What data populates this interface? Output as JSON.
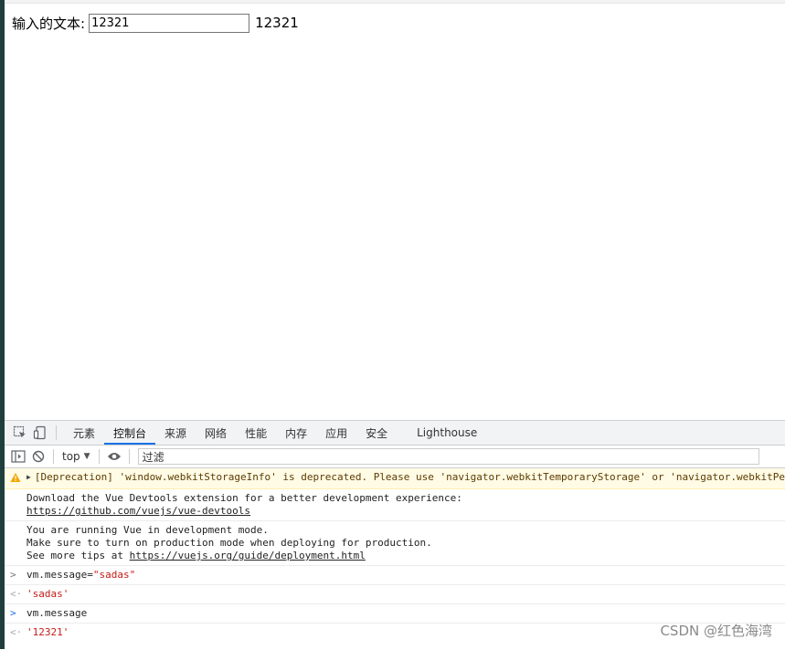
{
  "page": {
    "input_label": "输入的文本:",
    "input_value": "12321",
    "mirror_text": "12321"
  },
  "devtools": {
    "tabs": [
      {
        "label": "元素"
      },
      {
        "label": "控制台",
        "active": true
      },
      {
        "label": "来源"
      },
      {
        "label": "网络"
      },
      {
        "label": "性能"
      },
      {
        "label": "内存"
      },
      {
        "label": "应用"
      },
      {
        "label": "安全"
      },
      {
        "label": "Lighthouse"
      }
    ],
    "toolbar": {
      "context": "top",
      "filter_placeholder": "过滤"
    },
    "console": {
      "warning": "[Deprecation] 'window.webkitStorageInfo' is deprecated. Please use 'navigator.webkitTemporaryStorage' or 'navigator.webkitPersistentStorage' instead.",
      "devtools_msg": {
        "line1": "Download the Vue Devtools extension for a better development experience:",
        "link": "https://github.com/vuejs/vue-devtools"
      },
      "devmode_msg": {
        "line1": "You are running Vue in development mode.",
        "line2": "Make sure to turn on production mode when deploying for production.",
        "line3_prefix": "See more tips at ",
        "link": "https://vuejs.org/guide/deployment.html"
      },
      "entries": [
        {
          "kind": "input",
          "parts": {
            "a": "vm.message=",
            "b": "\"sadas\""
          }
        },
        {
          "kind": "output",
          "text": "'sadas'"
        },
        {
          "kind": "input",
          "text": "vm.message"
        },
        {
          "kind": "output",
          "text": "'12321'"
        }
      ]
    }
  },
  "watermark": "CSDN @红色海湾",
  "colors": {
    "accent": "#1a73e8",
    "string": "#c41a16",
    "warning_bg": "#fffbe5"
  }
}
